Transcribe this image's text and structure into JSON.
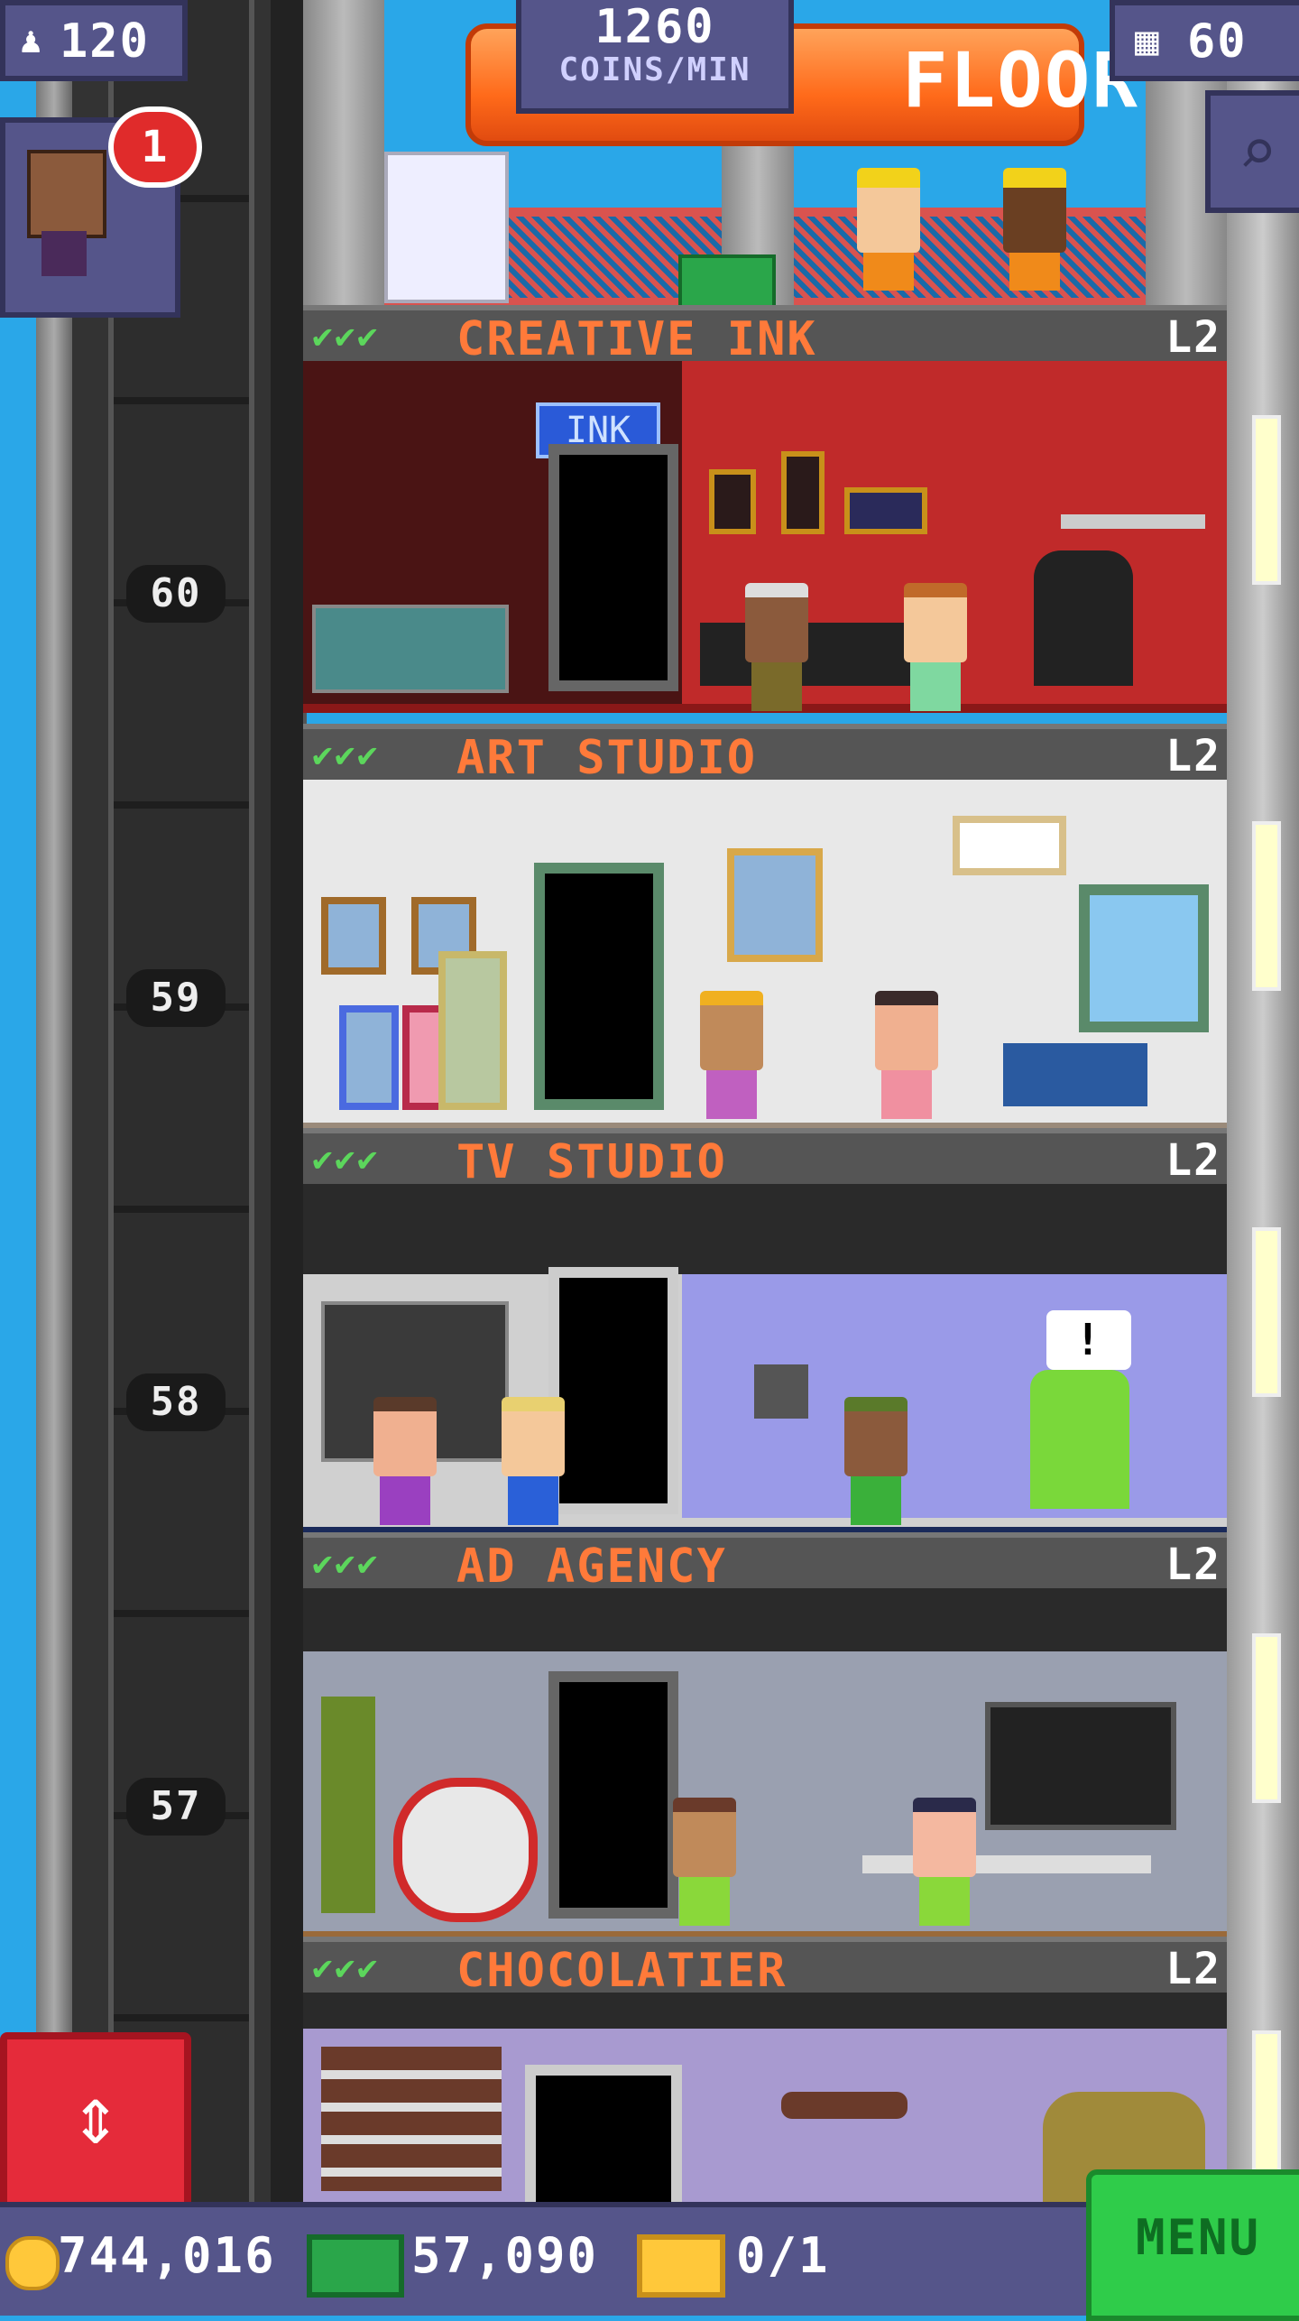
{
  "hud": {
    "population": "120",
    "coins_per_min_value": "1260",
    "coins_per_min_label": "COINS/MIN",
    "floor_count": "60",
    "lobby_sign": "FLOOR",
    "notification_count": "1"
  },
  "shaft_numbers": [
    "60",
    "59",
    "58",
    "57"
  ],
  "floors": [
    {
      "name": "CREATIVE INK",
      "level": "L2",
      "checks": "✔✔✔",
      "sign": "INK"
    },
    {
      "name": "ART STUDIO",
      "level": "L2",
      "checks": "✔✔✔"
    },
    {
      "name": "TV STUDIO",
      "level": "L2",
      "checks": "✔✔✔",
      "alert": "!"
    },
    {
      "name": "AD AGENCY",
      "level": "L2",
      "checks": "✔✔✔"
    },
    {
      "name": "CHOCOLATIER",
      "level": "L2",
      "checks": "✔✔✔"
    }
  ],
  "bottom_bar": {
    "coins": "744,016",
    "tower_bux": "57,090",
    "tickets": "0/1",
    "menu_label": "MENU"
  },
  "colors": {
    "sky": "#2aa7e8",
    "hud": "#55558a",
    "title_orange": "#ff7a3a",
    "check_green": "#5cd65c",
    "menu_green": "#2fcc4a",
    "elevator_red": "#e52b3a"
  }
}
